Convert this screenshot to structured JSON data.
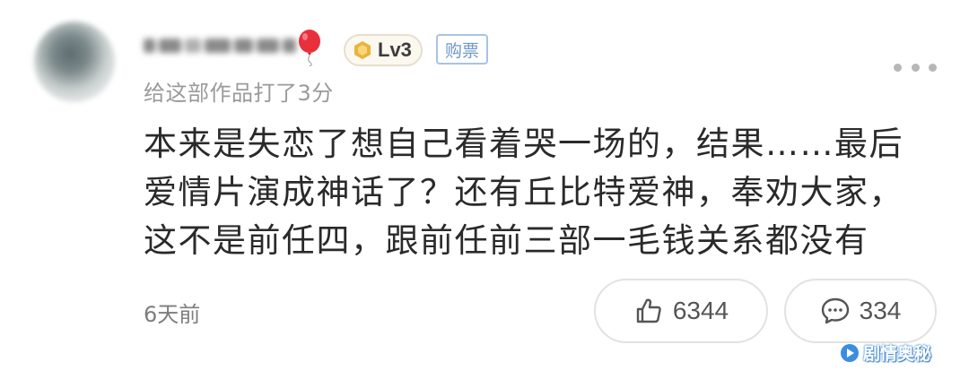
{
  "user": {
    "level_label": "Lv3",
    "bought_tag": "购票"
  },
  "rating_text": "给这部作品打了3分",
  "comment_lines": [
    "本来是失恋了想自己看着哭一场的，结果……最后",
    "爱情片演成神话了？还有丘比特爱神，奉劝大家，",
    "这不是前任四，跟前任前三部一毛钱关系都没有"
  ],
  "time_text": "6天前",
  "like_count": "6344",
  "reply_count": "334",
  "watermark_text": "剧情奥秘",
  "colors": {
    "badge_border": "#e6dfcf",
    "tag_blue": "#6f98c9",
    "meta_gray": "#9a9a9a",
    "balloon_red": "#e8303c"
  },
  "icons": [
    "avatar",
    "balloon-icon",
    "level-hex-icon",
    "more-icon",
    "thumb-up-icon",
    "comment-bubble-icon",
    "watermark-logo-icon"
  ]
}
